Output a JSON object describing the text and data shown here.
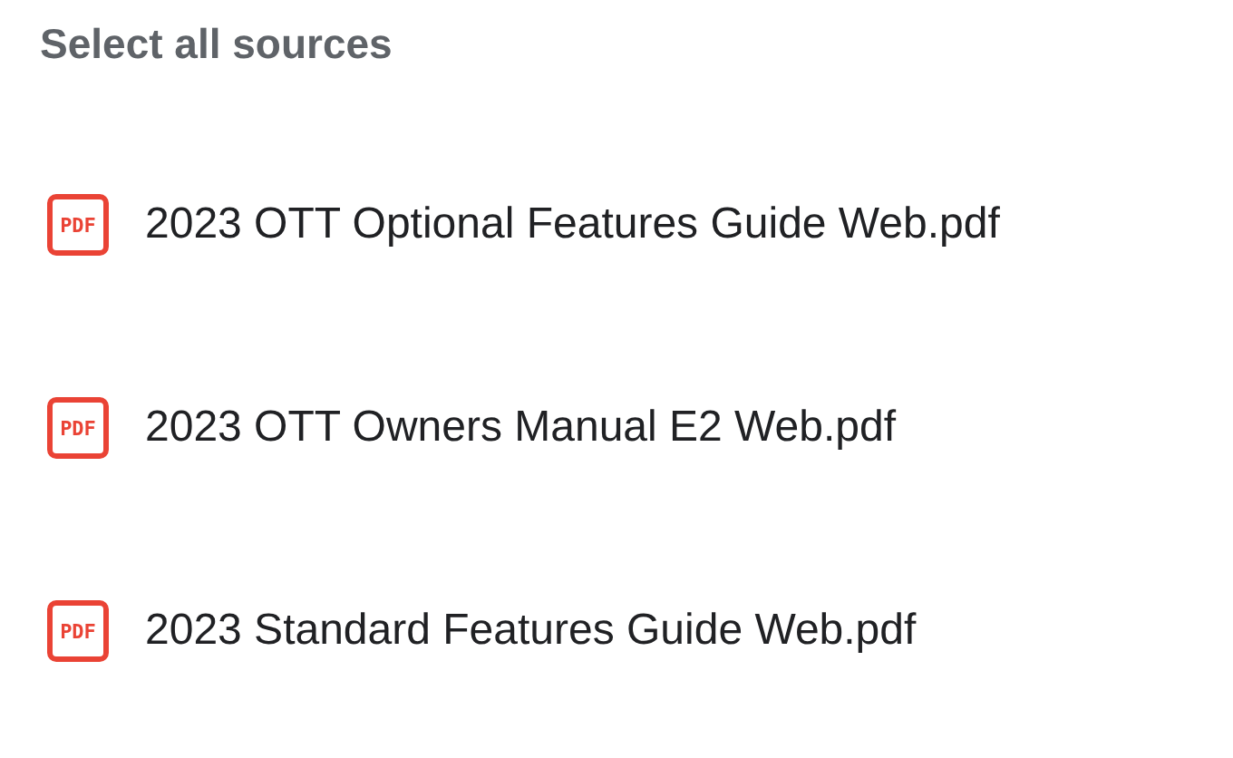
{
  "heading": "Select all sources",
  "sources": [
    {
      "icon_label": "PDF",
      "name": "2023 OTT Optional Features Guide Web.pdf"
    },
    {
      "icon_label": "PDF",
      "name": "2023 OTT Owners Manual E2 Web.pdf"
    },
    {
      "icon_label": "PDF",
      "name": "2023 Standard Features Guide Web.pdf"
    }
  ]
}
